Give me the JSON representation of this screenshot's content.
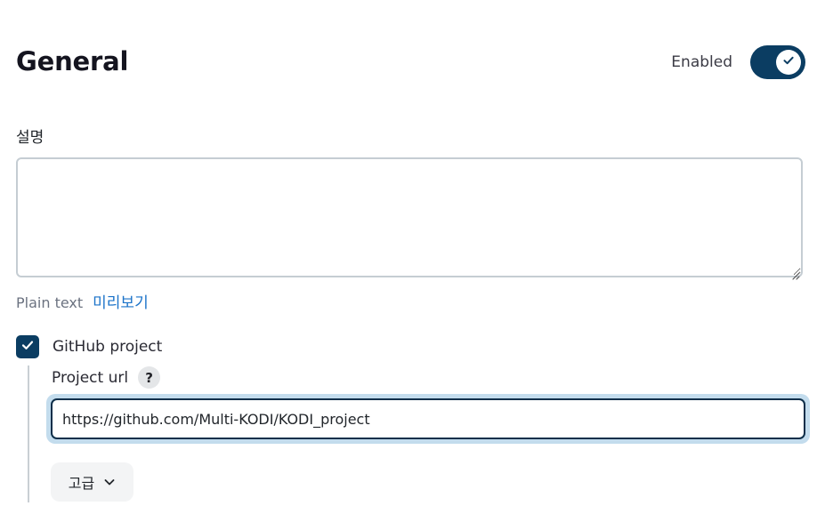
{
  "section": {
    "title": "General"
  },
  "enabled_toggle": {
    "label": "Enabled",
    "state": "on",
    "color": "#0b3d62"
  },
  "description": {
    "label": "설명",
    "value": ""
  },
  "format": {
    "mode_text": "Plain text",
    "preview_link": "미리보기"
  },
  "github_project": {
    "checked": true,
    "label": "GitHub project",
    "project_url_label": "Project url",
    "help_icon_text": "?",
    "project_url_value": "https://github.com/Multi-KODI/KODI_project"
  },
  "advanced": {
    "label": "고급",
    "icon": "chevron-down-icon"
  },
  "colors": {
    "accent": "#0b3d62",
    "link": "#1b73c9",
    "focus_ring": "#c3dced"
  }
}
